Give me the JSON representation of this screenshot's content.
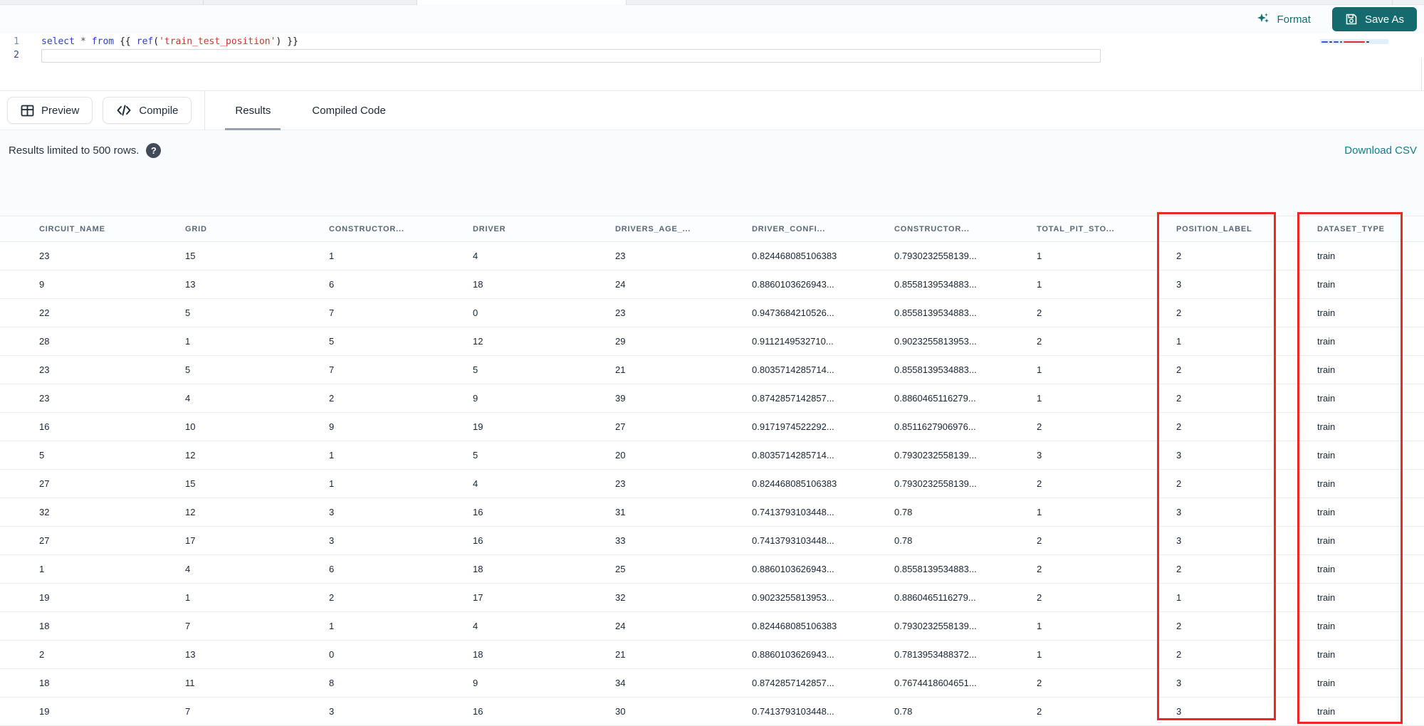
{
  "editor": {
    "toolbar": {
      "format": "Format",
      "save_as": "Save As"
    },
    "line_numbers": [
      "1",
      "2"
    ],
    "sql": {
      "kw_select": "select",
      "star": "*",
      "kw_from": "from",
      "jinja_open": "{{",
      "fn_ref": "ref",
      "paren_open": "(",
      "str": "'train_test_position'",
      "paren_close": ")",
      "jinja_close": "}}"
    }
  },
  "toolbar": {
    "preview": "Preview",
    "compile": "Compile",
    "tabs": [
      {
        "label": "Results",
        "active": true
      },
      {
        "label": "Compiled Code",
        "active": false
      }
    ]
  },
  "results": {
    "limit_text": "Results limited to 500 rows.",
    "help_glyph": "?",
    "download_csv": "Download CSV"
  },
  "table": {
    "columns": [
      "CIRCUIT_NAME",
      "GRID",
      "CONSTRUCTOR...",
      "DRIVER",
      "DRIVERS_AGE_...",
      "DRIVER_CONFI...",
      "CONSTRUCTOR...",
      "TOTAL_PIT_STO...",
      "POSITION_LABEL",
      "DATASET_TYPE"
    ],
    "rows": [
      [
        "23",
        "15",
        "1",
        "4",
        "23",
        "0.824468085106383",
        "0.7930232558139...",
        "1",
        "2",
        "train"
      ],
      [
        "9",
        "13",
        "6",
        "18",
        "24",
        "0.8860103626943...",
        "0.8558139534883...",
        "1",
        "3",
        "train"
      ],
      [
        "22",
        "5",
        "7",
        "0",
        "23",
        "0.9473684210526...",
        "0.8558139534883...",
        "2",
        "2",
        "train"
      ],
      [
        "28",
        "1",
        "5",
        "12",
        "29",
        "0.9112149532710...",
        "0.9023255813953...",
        "2",
        "1",
        "train"
      ],
      [
        "23",
        "5",
        "7",
        "5",
        "21",
        "0.8035714285714...",
        "0.8558139534883...",
        "1",
        "2",
        "train"
      ],
      [
        "23",
        "4",
        "2",
        "9",
        "39",
        "0.8742857142857...",
        "0.8860465116279...",
        "1",
        "2",
        "train"
      ],
      [
        "16",
        "10",
        "9",
        "19",
        "27",
        "0.9171974522292...",
        "0.8511627906976...",
        "2",
        "2",
        "train"
      ],
      [
        "5",
        "12",
        "1",
        "5",
        "20",
        "0.8035714285714...",
        "0.7930232558139...",
        "3",
        "3",
        "train"
      ],
      [
        "27",
        "15",
        "1",
        "4",
        "23",
        "0.824468085106383",
        "0.7930232558139...",
        "2",
        "2",
        "train"
      ],
      [
        "32",
        "12",
        "3",
        "16",
        "31",
        "0.7413793103448...",
        "0.78",
        "1",
        "3",
        "train"
      ],
      [
        "27",
        "17",
        "3",
        "16",
        "33",
        "0.7413793103448...",
        "0.78",
        "2",
        "3",
        "train"
      ],
      [
        "1",
        "4",
        "6",
        "18",
        "25",
        "0.8860103626943...",
        "0.8558139534883...",
        "2",
        "2",
        "train"
      ],
      [
        "19",
        "1",
        "2",
        "17",
        "32",
        "0.9023255813953...",
        "0.8860465116279...",
        "2",
        "1",
        "train"
      ],
      [
        "18",
        "7",
        "1",
        "4",
        "24",
        "0.824468085106383",
        "0.7930232558139...",
        "1",
        "2",
        "train"
      ],
      [
        "2",
        "13",
        "0",
        "18",
        "21",
        "0.8860103626943...",
        "0.7813953488372...",
        "1",
        "2",
        "train"
      ],
      [
        "18",
        "11",
        "8",
        "9",
        "34",
        "0.8742857142857...",
        "0.7674418604651...",
        "2",
        "3",
        "train"
      ],
      [
        "19",
        "7",
        "3",
        "16",
        "30",
        "0.7413793103448...",
        "0.78",
        "2",
        "3",
        "train"
      ]
    ],
    "highlighted_columns": [
      "POSITION_LABEL",
      "DATASET_TYPE"
    ]
  },
  "colors": {
    "accent_teal": "#156A6E",
    "link_teal": "#0F7E8C",
    "annotation_red": "#EE2626",
    "header_text": "#5A6677",
    "cell_text": "#1B2433",
    "sql_keyword": "#2A3FC9",
    "sql_string": "#D2342C"
  }
}
